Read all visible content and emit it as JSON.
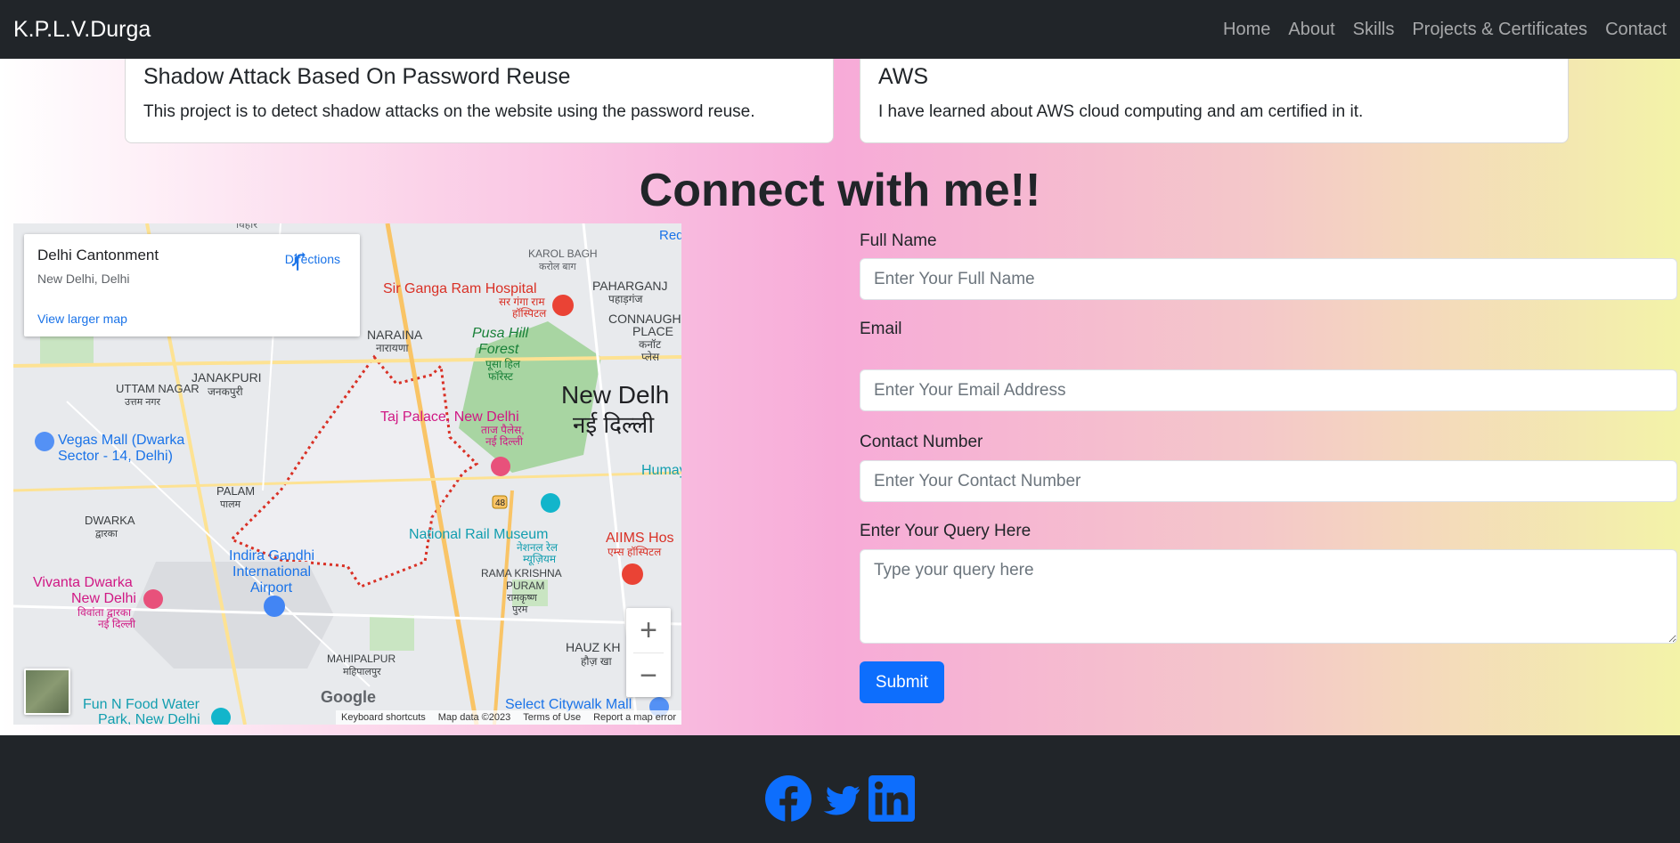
{
  "navbar": {
    "brand": "K.P.L.V.Durga",
    "links": [
      "Home",
      "About",
      "Skills",
      "Projects & Certificates",
      "Contact"
    ]
  },
  "cards": [
    {
      "title": "Shadow Attack Based On Password Reuse",
      "text": "This project is to detect shadow attacks on the website using the password reuse."
    },
    {
      "title": "AWS",
      "text": "I have learned about AWS cloud computing and am certified in it."
    }
  ],
  "section_title": "Connect with me!!",
  "map": {
    "place_name": "Delhi Cantonment",
    "place_address": "New Delhi, Delhi",
    "directions_label": "Directions",
    "larger_map_label": "View larger map",
    "zoom_in": "+",
    "zoom_out": "−",
    "google_logo": "Google",
    "footer": [
      "Keyboard shortcuts",
      "Map data ©2023",
      "Terms of Use",
      "Report a map error"
    ],
    "labels": {
      "vihar": "विहार",
      "karol_bagh": "KAROL BAGH",
      "karol_bagh_hi": "करोल बाग",
      "red": "Red",
      "sir_ganga": "Sir Ganga Ram Hospital",
      "sir_ganga_hi1": "सर गंगा राम",
      "sir_ganga_hi2": "हॉस्पिटल",
      "paharganj": "PAHARGANJ",
      "paharganj_hi": "पहाड़गंज",
      "connaught": "CONNAUGHT",
      "place": "PLACE",
      "connaught_hi": "कनॉट",
      "place_hi": "प्लेस",
      "naraina": "NARAINA",
      "naraina_hi": "नारायणा",
      "pusa_hill": "Pusa Hill",
      "forest": "Forest",
      "pusa_hi": "पूसा हिल",
      "forest_hi": "फॉरेस्ट",
      "uttam_nagar": "UTTAM NAGAR",
      "uttam_nagar_hi": "उत्तम नगर",
      "janakpuri": "JANAKPURI",
      "janakpuri_hi": "जनकपुरी",
      "new_delhi": "New Delh",
      "new_delhi_hi": "नई दिल्ली",
      "taj_palace": "Taj Palace, New Delhi",
      "taj_hi1": "ताज पैलेस,",
      "taj_hi2": "नई दिल्ली",
      "vegas_mall1": "Vegas Mall (Dwarka",
      "vegas_mall2": "Sector - 14, Delhi)",
      "humayu": "Humayu",
      "palam": "PALAM",
      "palam_hi": "पालम",
      "highway": "48",
      "dwarka": "DWARKA",
      "dwarka_hi": "द्वारका",
      "rail_museum": "National Rail Museum",
      "rail_hi1": "नेशनल रेल",
      "rail_hi2": "म्यूज़ियम",
      "aiims": "AIIMS Hos",
      "aiims_hi": "एम्स हॉस्पिटल",
      "igi1": "Indira Gandhi",
      "igi2": "International",
      "igi3": "Airport",
      "vivanta1": "Vivanta Dwarka",
      "vivanta2": "New Delhi",
      "vivanta_hi1": "विवांता द्वारका",
      "vivanta_hi2": "नई दिल्ली",
      "rk_puram1": "RAMA KRISHNA",
      "rk_puram2": "PURAM",
      "rk_hi1": "रामकृष्ण",
      "rk_hi2": "पुरम",
      "hauz_khas": "HAUZ KH",
      "hauz_hi": "हौज़ खा",
      "mahipalpur": "MAHIPALPUR",
      "mahipalpur_hi": "महिपालपुर",
      "fun_n_food1": "Fun N Food Water",
      "fun_n_food2": "Park, New Delhi",
      "select_citywalk": "Select Citywalk Mall"
    }
  },
  "form": {
    "fields": [
      {
        "label": "Full Name",
        "placeholder": "Enter Your Full Name"
      },
      {
        "label": "Email",
        "placeholder": "Enter Your Email Address"
      },
      {
        "label": "Contact Number",
        "placeholder": "Enter Your Contact Number"
      },
      {
        "label": "Enter Your Query Here",
        "placeholder": "Type your query here"
      }
    ],
    "submit_label": "Submit"
  },
  "colors": {
    "navbar": "#212529",
    "primary": "#0d6efd",
    "social": "#0d6efd"
  }
}
